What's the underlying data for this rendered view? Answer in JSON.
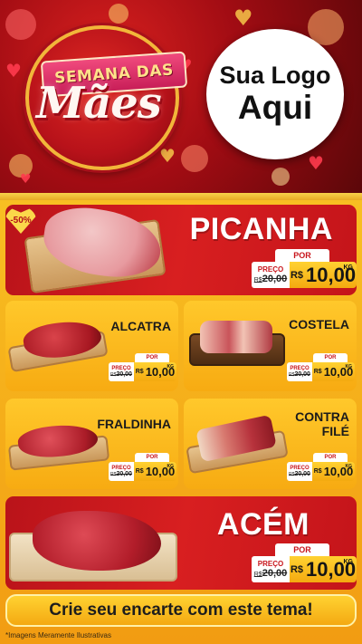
{
  "header": {
    "badge_line1": "SEMANA DAS",
    "badge_line2": "Mães",
    "logo_line1": "Sua Logo",
    "logo_line2": "Aqui"
  },
  "discount_badge": "-50%",
  "products": [
    {
      "name": "PICANHA",
      "por": "POR",
      "preco": "PREÇO",
      "old_prefix": "R$",
      "old": "20,00",
      "currency": "R$",
      "price": "10,00",
      "unit": "KG"
    },
    {
      "name": "ALCATRA",
      "por": "POR",
      "preco": "PREÇO",
      "old_prefix": "R$",
      "old": "20,00",
      "currency": "R$",
      "price": "10,00",
      "unit": "KG"
    },
    {
      "name": "COSTELA",
      "por": "POR",
      "preco": "PREÇO",
      "old_prefix": "R$",
      "old": "20,00",
      "currency": "R$",
      "price": "10,00",
      "unit": "KG"
    },
    {
      "name": "FRALDINHA",
      "por": "POR",
      "preco": "PREÇO",
      "old_prefix": "R$",
      "old": "20,00",
      "currency": "R$",
      "price": "10,00",
      "unit": "KG"
    },
    {
      "name_line1": "CONTRA",
      "name_line2": "FILÉ",
      "por": "POR",
      "preco": "PREÇO",
      "old_prefix": "R$",
      "old": "20,00",
      "currency": "R$",
      "price": "10,00",
      "unit": "KG"
    },
    {
      "name": "ACÉM",
      "por": "POR",
      "preco": "PREÇO",
      "old_prefix": "R$",
      "old": "20,00",
      "currency": "R$",
      "price": "10,00",
      "unit": "KG"
    }
  ],
  "cta": "Crie seu encarte com este tema!",
  "footnote": "*Imagens Meramente Ilustrativas",
  "colors": {
    "red": "#d81f20",
    "gold": "#f7b81a",
    "dark": "#151515"
  }
}
